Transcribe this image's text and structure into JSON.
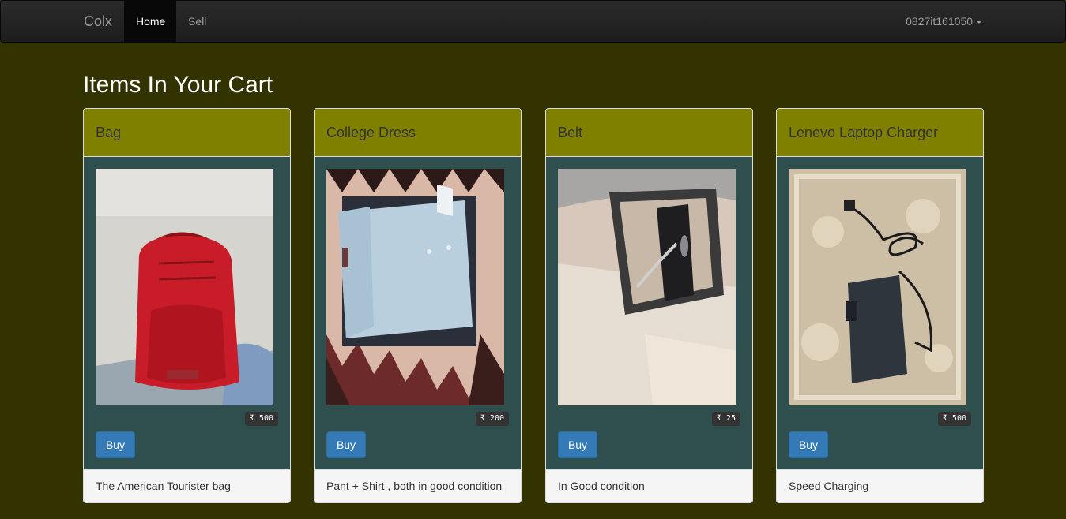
{
  "navbar": {
    "brand": "Colx",
    "items": [
      {
        "label": "Home",
        "active": true
      },
      {
        "label": "Sell",
        "active": false
      }
    ],
    "user": "0827it161050"
  },
  "page": {
    "title": "Items In Your Cart"
  },
  "cards": [
    {
      "title": "Bag",
      "price": "₹ 500",
      "buy_label": "Buy",
      "description": "The American Tourister bag"
    },
    {
      "title": "College Dress",
      "price": "₹ 200",
      "buy_label": "Buy",
      "description": "Pant + Shirt , both in good condition"
    },
    {
      "title": "Belt",
      "price": "₹ 25",
      "buy_label": "Buy",
      "description": "In Good condition"
    },
    {
      "title": "Lenevo Laptop Charger",
      "price": "₹ 500",
      "buy_label": "Buy",
      "description": "Speed Charging"
    }
  ],
  "colors": {
    "page_bg": "#333300",
    "card_header": "#808000",
    "card_body": "#2f4f4f",
    "button": "#337ab7"
  }
}
